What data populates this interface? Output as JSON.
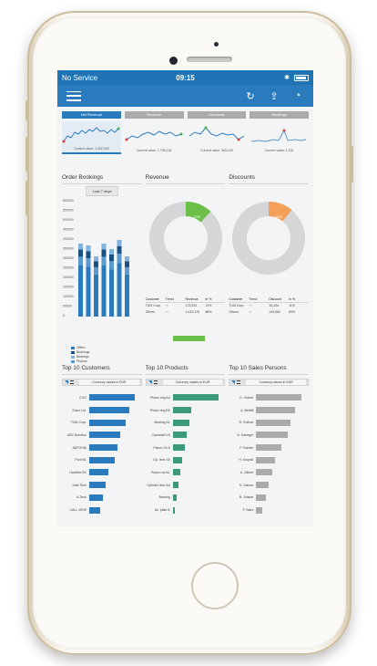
{
  "status_bar": {
    "carrier": "No Service",
    "time": "09:15"
  },
  "kpis": [
    {
      "label": "Net Revenue",
      "caption": "Current value: 1,432,000",
      "active": true
    },
    {
      "label": "Revenue",
      "caption": "Current value: 1,795,135",
      "active": false
    },
    {
      "label": "Discounts",
      "caption": "Current value: 363,135",
      "active": false
    },
    {
      "label": "Bookings",
      "caption": "Current value: 1,202",
      "active": false
    }
  ],
  "order_bookings": {
    "title": "Order Bookings",
    "range_button": "Last 7 days",
    "y_ticks": [
      "600000",
      "550000",
      "500000",
      "450000",
      "400000",
      "350000",
      "300000",
      "250000",
      "200000",
      "150000",
      "100000",
      "50000",
      "0"
    ],
    "legend": [
      "Offers",
      "Bookings",
      "Bearings",
      "Pistons"
    ]
  },
  "revenue": {
    "title": "Revenue",
    "percent_label": "12%",
    "headers": [
      "Customer",
      "Trend",
      "Revenue",
      "In %"
    ],
    "rows": [
      [
        "TUM Corp.",
        "",
        "173,534",
        "12%"
      ],
      [
        "Others",
        "",
        "1,432,124",
        "88%"
      ]
    ]
  },
  "discounts": {
    "title": "Discounts",
    "percent_label": "11%",
    "headers": [
      "Customer",
      "Trend",
      "Discount",
      "In %"
    ],
    "rows": [
      [
        "TUM Corp.",
        "",
        "18,434",
        "11%"
      ],
      [
        "Others",
        "",
        "149,562",
        "89%"
      ]
    ]
  },
  "top_customers": {
    "title": "Top 10 Customers",
    "filter_label": "Currency values in EUR",
    "color": "#2a7bbd",
    "items": [
      {
        "name": "CGG",
        "value": 100
      },
      {
        "name": "Solun Ltd.",
        "value": 88
      },
      {
        "name": "TUM Corp.",
        "value": 80
      },
      {
        "name": "ABC Bonetus",
        "value": 68
      },
      {
        "name": "ADFGHIA",
        "value": 62
      },
      {
        "name": "Ford NL",
        "value": 55
      },
      {
        "name": "Hanelbe BV",
        "value": 42
      },
      {
        "name": "Kate Tech",
        "value": 36
      },
      {
        "name": "A-Tech",
        "value": 30
      },
      {
        "name": "CALL VIEW",
        "value": 24
      }
    ]
  },
  "top_products": {
    "title": "Top 10 Products",
    "filter_label": "Currency values in EUR",
    "color": "#3a9a7a",
    "items": [
      {
        "name": "Piston ring A4",
        "value": 100
      },
      {
        "name": "Piston ring B5",
        "value": 40
      },
      {
        "name": "Bearing A1",
        "value": 36
      },
      {
        "name": "Camshaft V6",
        "value": 30
      },
      {
        "name": "Piston G4.5",
        "value": 27
      },
      {
        "name": "Cyl. liner A5",
        "value": 20
      },
      {
        "name": "Piston rod A1",
        "value": 16
      },
      {
        "name": "Cylinder liner A6",
        "value": 12
      },
      {
        "name": "Bearing",
        "value": 8
      },
      {
        "name": "Air. plate B",
        "value": 4
      }
    ]
  },
  "top_sales": {
    "title": "Top 10 Sales Persons",
    "filter_label": "Currency values in EUR",
    "color": "#a9abad",
    "items": [
      {
        "name": "G. Hobert",
        "value": 100
      },
      {
        "name": "A. Bethiff",
        "value": 86
      },
      {
        "name": "R. Rothoir",
        "value": 76
      },
      {
        "name": "N. Haneger",
        "value": 70
      },
      {
        "name": "F. Ramier",
        "value": 55
      },
      {
        "name": "H. Krupski",
        "value": 42
      },
      {
        "name": "A. Gilbert",
        "value": 35
      },
      {
        "name": "S. Jolmon",
        "value": 28
      },
      {
        "name": "B. Jolaine",
        "value": 22
      },
      {
        "name": "P. Bairs",
        "value": 14
      }
    ]
  }
}
